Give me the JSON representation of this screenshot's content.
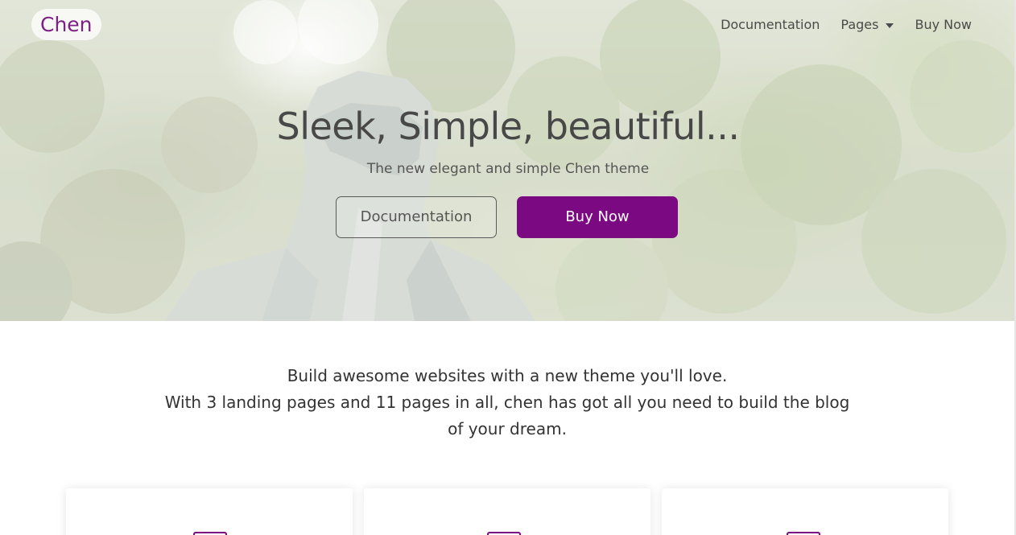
{
  "brand": {
    "name": "Chen",
    "color": "#7d1f86"
  },
  "nav": {
    "items": [
      {
        "label": "Documentation"
      },
      {
        "label": "Pages",
        "has_dropdown": true
      },
      {
        "label": "Buy Now"
      }
    ]
  },
  "hero": {
    "title": "Sleek, Simple, beautiful...",
    "subtitle": "The new elegant and simple Chen theme",
    "buttons": {
      "documentation": "Documentation",
      "buy_now": "Buy Now"
    },
    "accent_color": "#7b0a82"
  },
  "intro": {
    "line1": "Build awesome websites with a new theme you'll love.",
    "line2": "With 3 landing pages and 11 pages in all, chen has got all you need to build the blog of your dream."
  },
  "feature_cards": [
    {
      "icon": "layout-icon"
    },
    {
      "icon": "pages-icon"
    },
    {
      "icon": "blog-icon"
    }
  ]
}
